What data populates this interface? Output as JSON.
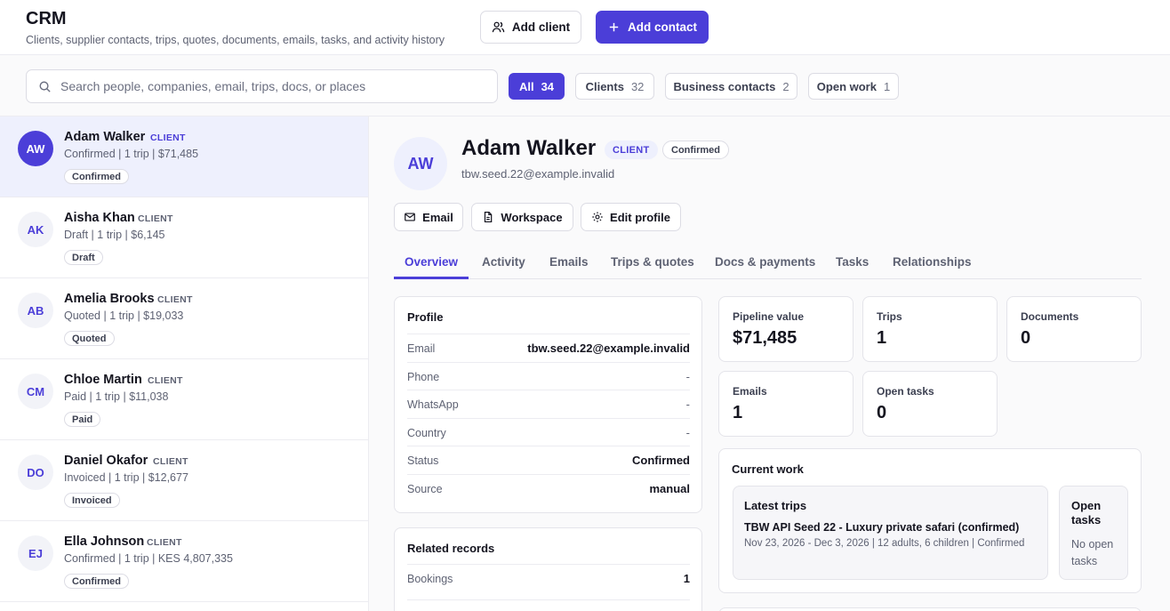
{
  "header": {
    "title": "CRM",
    "subtitle": "Clients, supplier contacts, trips, quotes, documents, emails, tasks, and activity history",
    "add_client_label": "Add client",
    "add_contact_label": "Add contact"
  },
  "search": {
    "placeholder": "Search people, companies, email, trips, docs, or places",
    "value": ""
  },
  "filters": [
    {
      "label": "All",
      "count": "34",
      "active": true
    },
    {
      "label": "Clients",
      "count": "32",
      "active": false
    },
    {
      "label": "Business contacts",
      "count": "2",
      "active": false
    },
    {
      "label": "Open work",
      "count": "1",
      "active": false
    }
  ],
  "clients": [
    {
      "initials": "AW",
      "name": "Adam Walker",
      "tag": "CLIENT",
      "meta": "Confirmed | 1 trip | $71,485",
      "status": "Confirmed",
      "selected": true
    },
    {
      "initials": "AK",
      "name": "Aisha Khan",
      "tag": "CLIENT",
      "meta": "Draft | 1 trip | $6,145",
      "status": "Draft",
      "selected": false
    },
    {
      "initials": "AB",
      "name": "Amelia Brooks",
      "tag": "CLIENT",
      "meta": "Quoted | 1 trip | $19,033",
      "status": "Quoted",
      "selected": false
    },
    {
      "initials": "CM",
      "name": "Chloe Martin",
      "tag": "CLIENT",
      "meta": "Paid | 1 trip | $11,038",
      "status": "Paid",
      "selected": false
    },
    {
      "initials": "DO",
      "name": "Daniel Okafor",
      "tag": "CLIENT",
      "meta": "Invoiced | 1 trip | $12,677",
      "status": "Invoiced",
      "selected": false
    },
    {
      "initials": "EJ",
      "name": "Ella Johnson",
      "tag": "CLIENT",
      "meta": "Confirmed | 1 trip | KES 4,807,335",
      "status": "Confirmed",
      "selected": false
    }
  ],
  "detail": {
    "initials": "AW",
    "name": "Adam Walker",
    "tag": "CLIENT",
    "status": "Confirmed",
    "email": "tbw.seed.22@example.invalid",
    "actions": {
      "email": "Email",
      "workspace": "Workspace",
      "edit": "Edit profile"
    },
    "tabs": [
      "Overview",
      "Activity",
      "Emails",
      "Trips & quotes",
      "Docs & payments",
      "Tasks",
      "Relationships"
    ],
    "active_tab": "Overview",
    "profile": {
      "title": "Profile",
      "rows": [
        {
          "label": "Email",
          "value": "tbw.seed.22@example.invalid"
        },
        {
          "label": "Phone",
          "value": "-"
        },
        {
          "label": "WhatsApp",
          "value": "-"
        },
        {
          "label": "Country",
          "value": "-"
        },
        {
          "label": "Status",
          "value": "Confirmed"
        },
        {
          "label": "Source",
          "value": "manual"
        }
      ]
    },
    "related": {
      "title": "Related records",
      "rows": [
        {
          "label": "Bookings",
          "value": "1"
        }
      ]
    },
    "stats": [
      {
        "label": "Pipeline value",
        "value": "$71,485"
      },
      {
        "label": "Trips",
        "value": "1"
      },
      {
        "label": "Documents",
        "value": "0"
      },
      {
        "label": "Emails",
        "value": "1"
      },
      {
        "label": "Open tasks",
        "value": "0"
      }
    ],
    "current_work": {
      "title": "Current work",
      "latest_title": "Latest trips",
      "trip_name": "TBW API Seed 22 - Luxury private safari (confirmed)",
      "trip_meta": "Nov 23, 2026 - Dec 3, 2026 | 12 adults, 6 children | Confirmed",
      "open_title": "Open tasks",
      "open_empty": "No open tasks"
    }
  },
  "colors": {
    "accent": "#4b3ed8",
    "selected_row": "#eef0fd"
  }
}
